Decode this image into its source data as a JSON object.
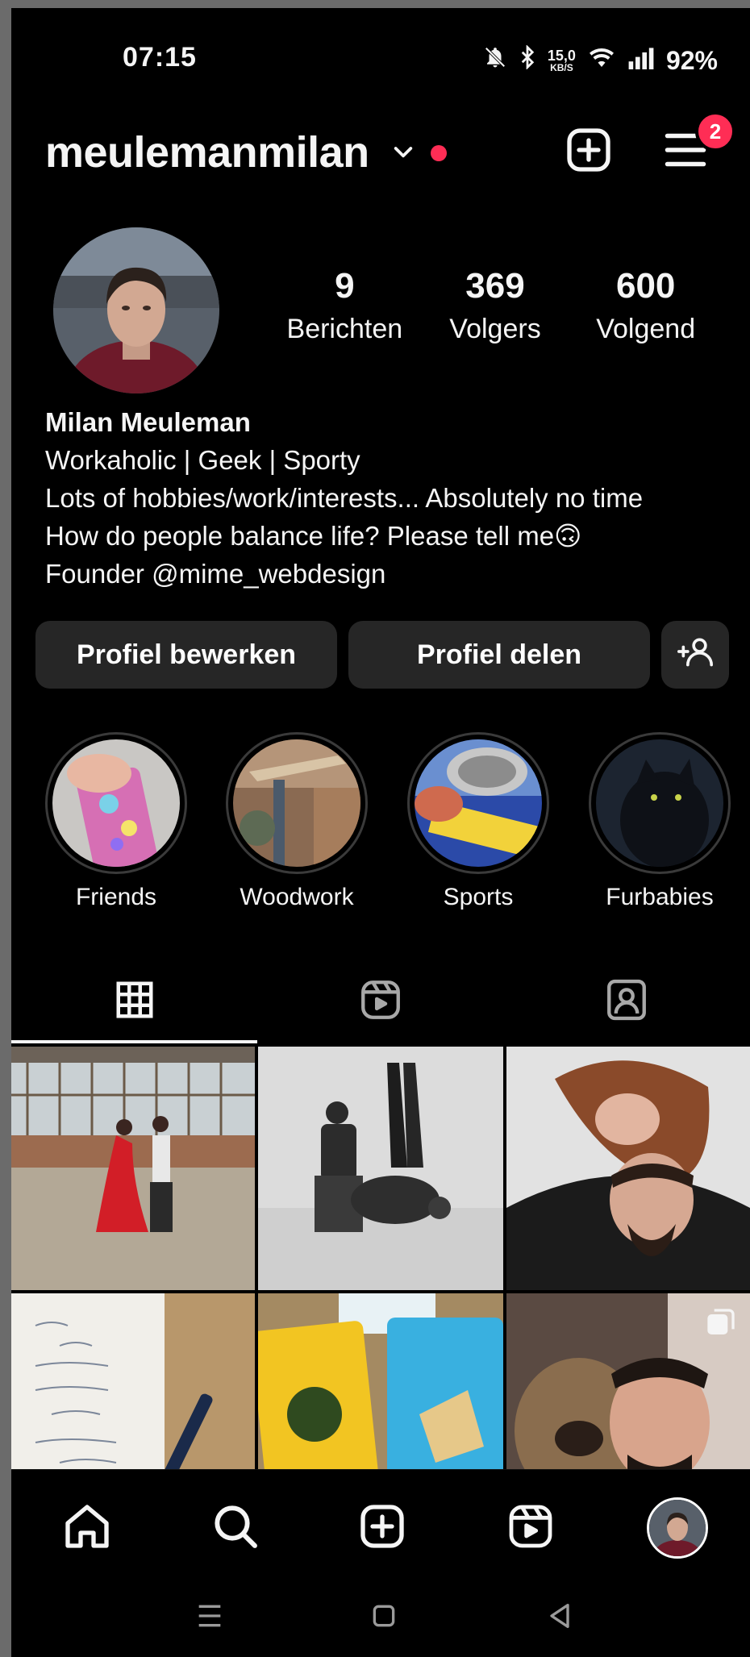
{
  "status_bar": {
    "time": "07:15",
    "speed_value": "15,0",
    "speed_unit": "KB/S",
    "battery": "92%"
  },
  "header": {
    "username": "meulemanmilan",
    "notification_count": "2"
  },
  "profile": {
    "stats": [
      {
        "value": "9",
        "label": "Berichten"
      },
      {
        "value": "369",
        "label": "Volgers"
      },
      {
        "value": "600",
        "label": "Volgend"
      }
    ],
    "name": "Milan Meuleman",
    "bio_lines": [
      "Workaholic | Geek | Sporty",
      "Lots of hobbies/work/interests... Absolutely no time",
      "How do people balance life? Please tell me🙃",
      "Founder @mime_webdesign"
    ]
  },
  "buttons": {
    "edit_profile": "Profiel bewerken",
    "share_profile": "Profiel delen"
  },
  "highlights": [
    {
      "label": "Friends"
    },
    {
      "label": "Woodwork"
    },
    {
      "label": "Sports"
    },
    {
      "label": "Furbabies"
    }
  ],
  "tabs": [
    "grid-icon",
    "reels-icon",
    "tagged-icon"
  ],
  "bottom_nav": [
    "home-icon",
    "search-icon",
    "create-icon",
    "reels-icon",
    "profile-avatar"
  ],
  "colors": {
    "background": "#000000",
    "button": "#262626",
    "badge": "#ff2d55"
  }
}
